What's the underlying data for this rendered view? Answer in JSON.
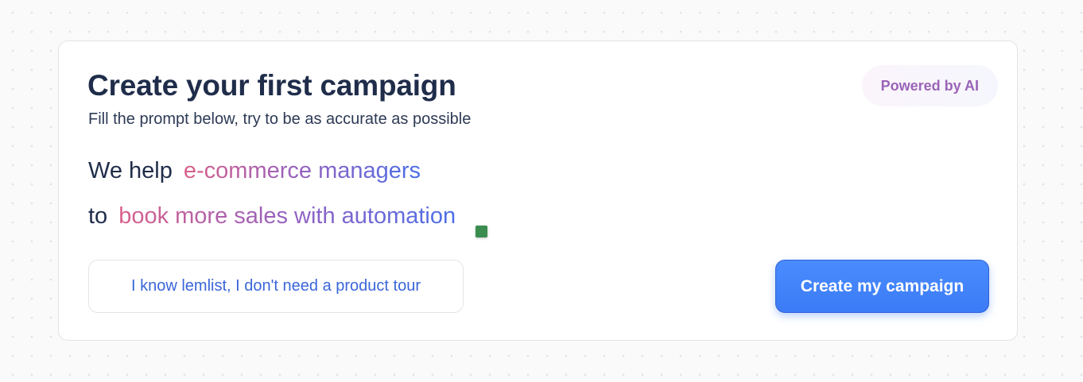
{
  "header": {
    "title": "Create your first campaign",
    "subtitle": "Fill the prompt below, try to be as accurate as possible",
    "badge": "Powered by AI"
  },
  "prompt": {
    "line1_prefix": "We help",
    "line1_value": "e-commerce managers",
    "line2_prefix": "to",
    "line2_value": "book more sales with automation"
  },
  "actions": {
    "skip_tour_label": "I know lemlist, I don't need a product tour",
    "create_label": "Create my campaign"
  },
  "colors": {
    "title": "#1f2d4a",
    "gradient_start": "#d9608a",
    "gradient_mid": "#8e62c4",
    "gradient_end": "#4a6ee8",
    "primary_button": "#3b7bf5",
    "link_text": "#3a66d9",
    "badge_text": "#9a64b8"
  }
}
